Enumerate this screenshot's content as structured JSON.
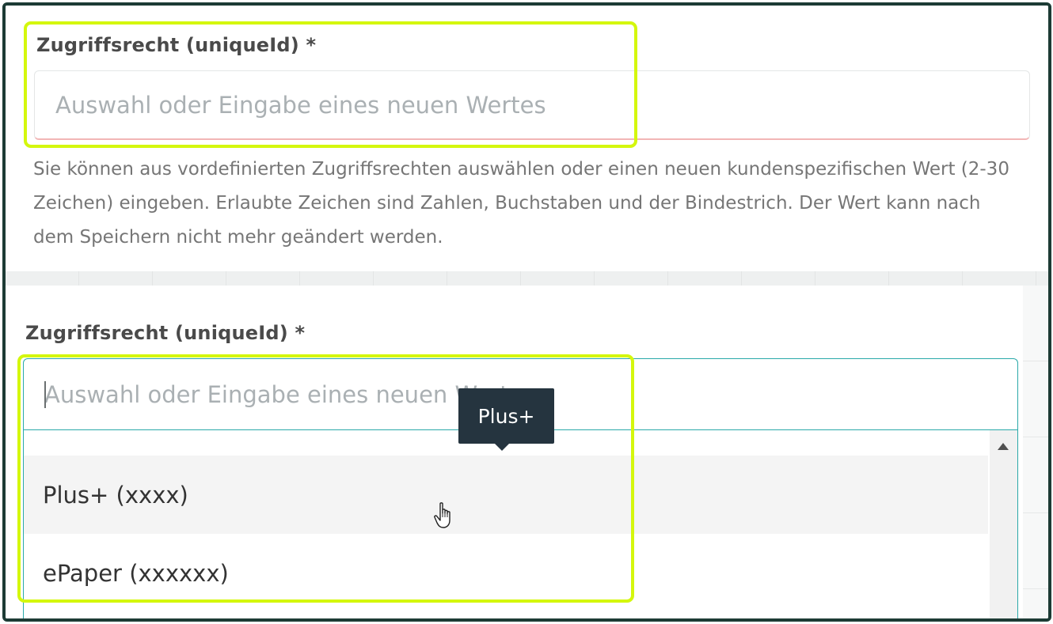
{
  "form_a": {
    "label": "Zugriffsrecht (uniqueId) *",
    "placeholder": "Auswahl oder Eingabe eines neuen Wertes",
    "help_text": "Sie können aus vordefinierten Zugriffsrechten auswählen oder einen neuen kundenspezifischen Wert (2-30 Zeichen) eingeben. Erlaubte Zeichen sind Zahlen, Buchstaben und der Bindestrich. Der Wert kann nach dem Speichern nicht mehr geändert werden."
  },
  "form_b": {
    "label": "Zugriffsrecht (uniqueId) *",
    "placeholder": "Auswahl oder Eingabe eines neuen Wertes",
    "tooltip": "Plus+",
    "options": [
      {
        "label": "Plus+ (xxxx)",
        "hovered": true
      },
      {
        "label": "ePaper (xxxxxx)",
        "hovered": false
      }
    ]
  },
  "colors": {
    "highlight": "#d4f70d",
    "focus_border": "#2aa9a9",
    "tooltip_bg": "#25343f",
    "frame_border": "#1d3b35"
  },
  "icons": [
    "scroll-up-arrow-icon",
    "hand-pointer-cursor-icon"
  ]
}
